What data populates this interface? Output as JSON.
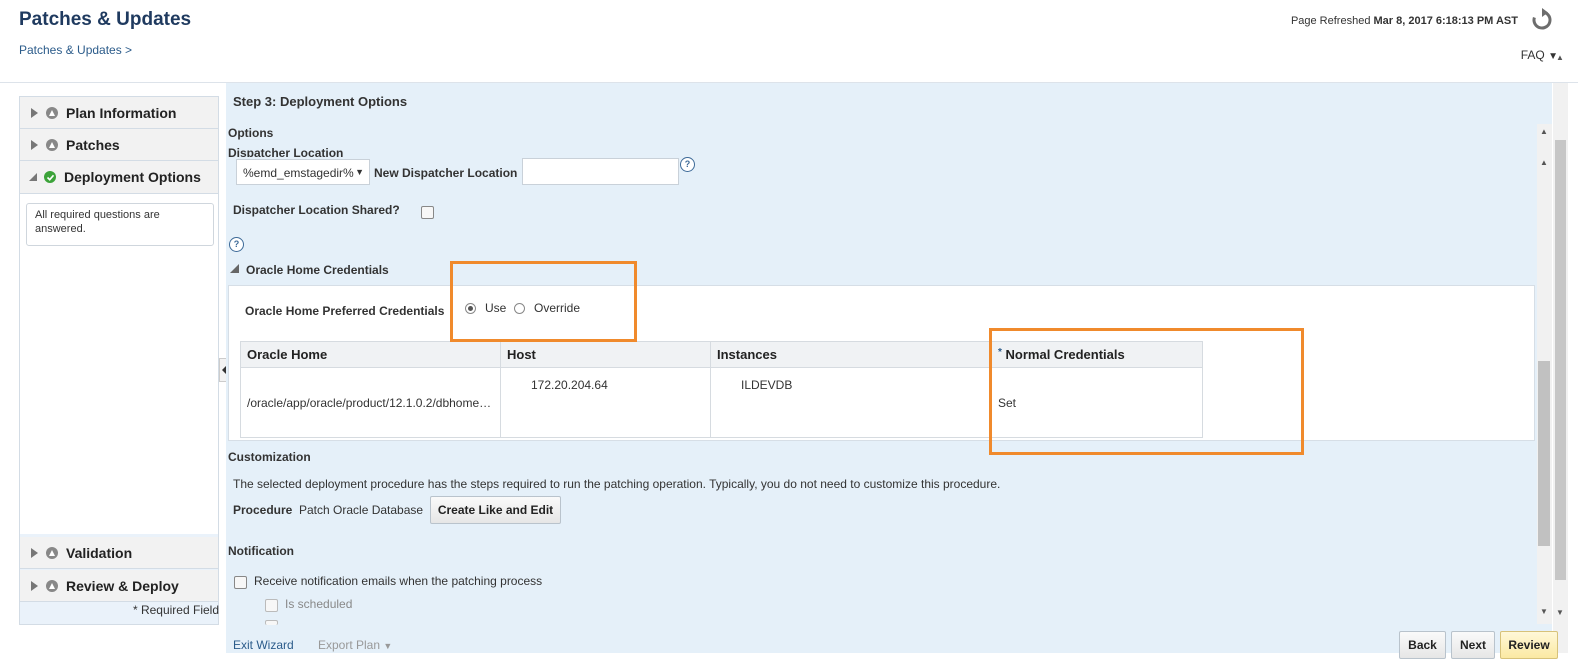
{
  "header": {
    "title": "Patches & Updates",
    "breadcrumb": "Patches & Updates >",
    "refreshed_label": "Page Refreshed",
    "refreshed_value": "Mar 8, 2017 6:18:13 PM AST",
    "faq": "FAQ"
  },
  "train": {
    "items": [
      {
        "label": "Plan Information"
      },
      {
        "label": "Patches"
      },
      {
        "label": "Deployment Options"
      },
      {
        "label": "Validation"
      },
      {
        "label": "Review & Deploy"
      }
    ],
    "status_message": "All required questions are answered.",
    "required_note": "* Required Field"
  },
  "main": {
    "step_title": "Step 3: Deployment Options",
    "options_label": "Options",
    "dispatcher_label": "Dispatcher Location",
    "dispatcher_select": "%emd_emstagedir%",
    "new_dispatcher_label": "New Dispatcher Location",
    "dispatcher_shared_label": "Dispatcher Location Shared?",
    "oh_credentials_title": "Oracle Home Credentials",
    "oh_preferred_label": "Oracle Home Preferred Credentials",
    "radio_use": "Use",
    "radio_override": "Override",
    "table": {
      "headers": [
        "Oracle Home",
        "Host",
        "Instances",
        "Normal Credentials"
      ],
      "required_mark": "*",
      "rows": [
        [
          "/oracle/app/oracle/product/12.1.0.2/dbhome…",
          "172.20.204.64",
          "ILDEVDB",
          "Set"
        ]
      ]
    },
    "customization_label": "Customization",
    "customization_text": "The selected deployment procedure has the steps required to run the patching operation. Typically, you do not need to customize this procedure.",
    "procedure_label": "Procedure",
    "procedure_value": "Patch Oracle Database",
    "create_like_button": "Create Like and Edit",
    "notification_label": "Notification",
    "notify_checkbox": "Receive notification emails when the patching process",
    "is_scheduled": "Is scheduled"
  },
  "footer": {
    "exit_wizard": "Exit Wizard",
    "export_plan": "Export Plan",
    "back": "Back",
    "next": "Next",
    "review": "Review"
  },
  "colors": {
    "highlight": "#f08a2c",
    "panel_bg": "#e5f0f9",
    "title": "#1f3a5f"
  }
}
